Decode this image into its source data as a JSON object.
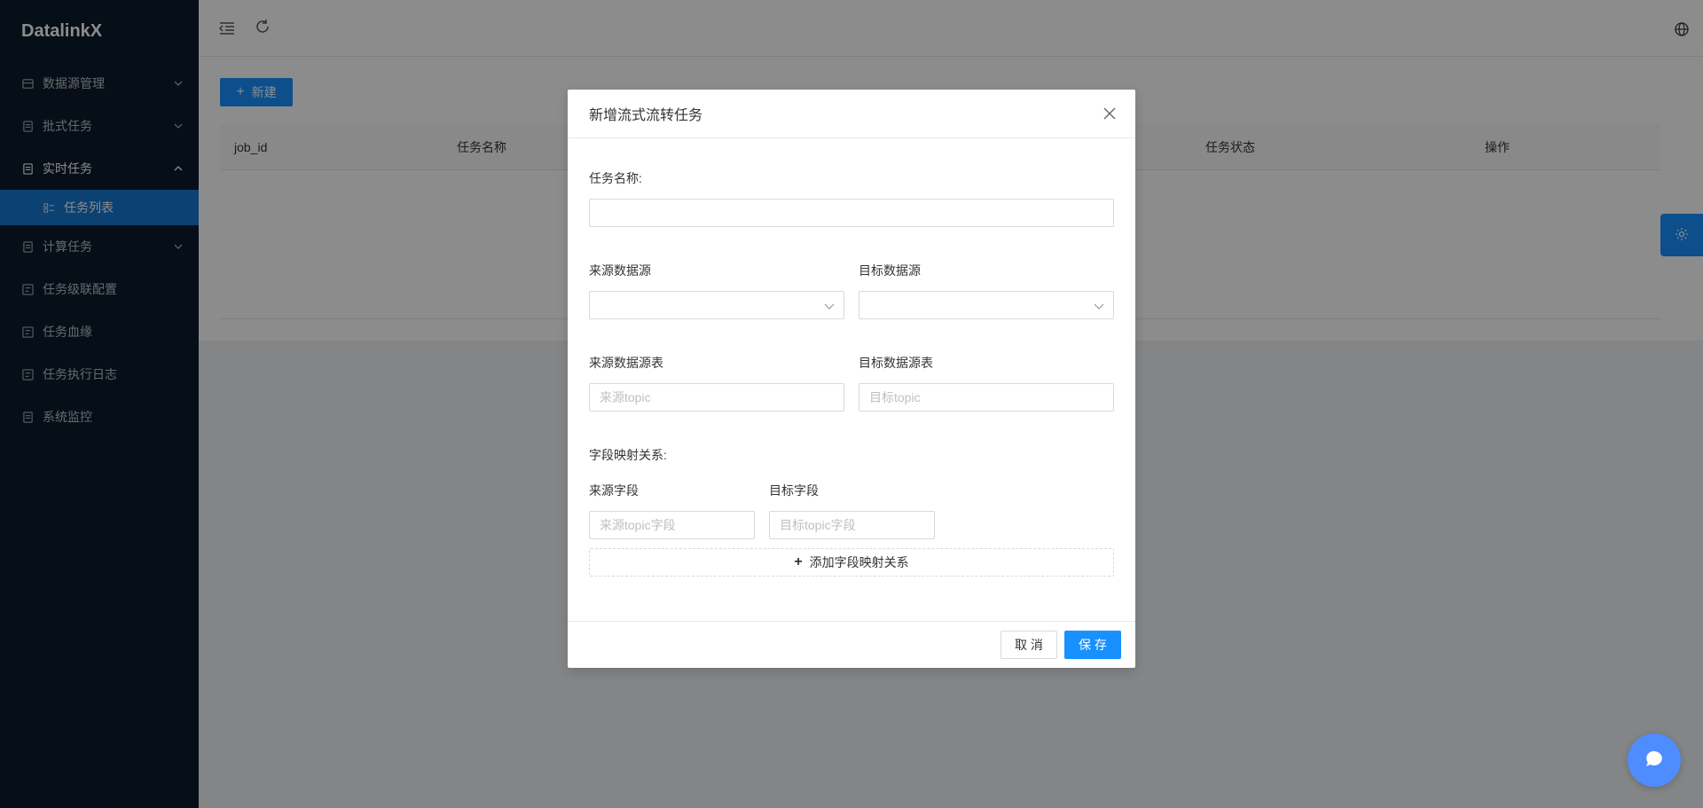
{
  "app": {
    "title": "DatalinkX"
  },
  "sidebar": {
    "items": [
      {
        "label": "数据源管理",
        "icon": "database-icon",
        "expandable": true,
        "open": false
      },
      {
        "label": "批式任务",
        "icon": "batch-task-icon",
        "expandable": true,
        "open": false
      },
      {
        "label": "实时任务",
        "icon": "realtime-task-icon",
        "expandable": true,
        "open": true
      },
      {
        "label": "计算任务",
        "icon": "compute-task-icon",
        "expandable": true,
        "open": false
      },
      {
        "label": "任务级联配置",
        "icon": "cascade-config-icon",
        "expandable": false
      },
      {
        "label": "任务血缘",
        "icon": "lineage-icon",
        "expandable": false
      },
      {
        "label": "任务执行日志",
        "icon": "log-icon",
        "expandable": false
      },
      {
        "label": "系统监控",
        "icon": "monitor-icon",
        "expandable": false
      }
    ],
    "active_sub": {
      "label": "任务列表",
      "icon": "list-icon"
    }
  },
  "toolbar": {
    "new_label": "新建"
  },
  "table": {
    "columns": [
      "job_id",
      "任务名称",
      "任务状态",
      "操作"
    ]
  },
  "modal": {
    "title": "新增流式流转任务",
    "task_name_label": "任务名称:",
    "task_name_value": "",
    "source_ds_label": "来源数据源",
    "target_ds_label": "目标数据源",
    "source_table_label": "来源数据源表",
    "target_table_label": "目标数据源表",
    "source_topic_placeholder": "来源topic",
    "target_topic_placeholder": "目标topic",
    "mapping_label": "字段映射关系:",
    "source_field_label": "来源字段",
    "target_field_label": "目标字段",
    "source_field_placeholder": "来源topic字段",
    "target_field_placeholder": "目标topic字段",
    "add_mapping_label": "添加字段映射关系",
    "cancel_label": "取 消",
    "save_label": "保 存"
  },
  "colors": {
    "primary": "#1890ff",
    "sidebar_bg": "#0b1a2d",
    "chat": "#4e8cff"
  }
}
